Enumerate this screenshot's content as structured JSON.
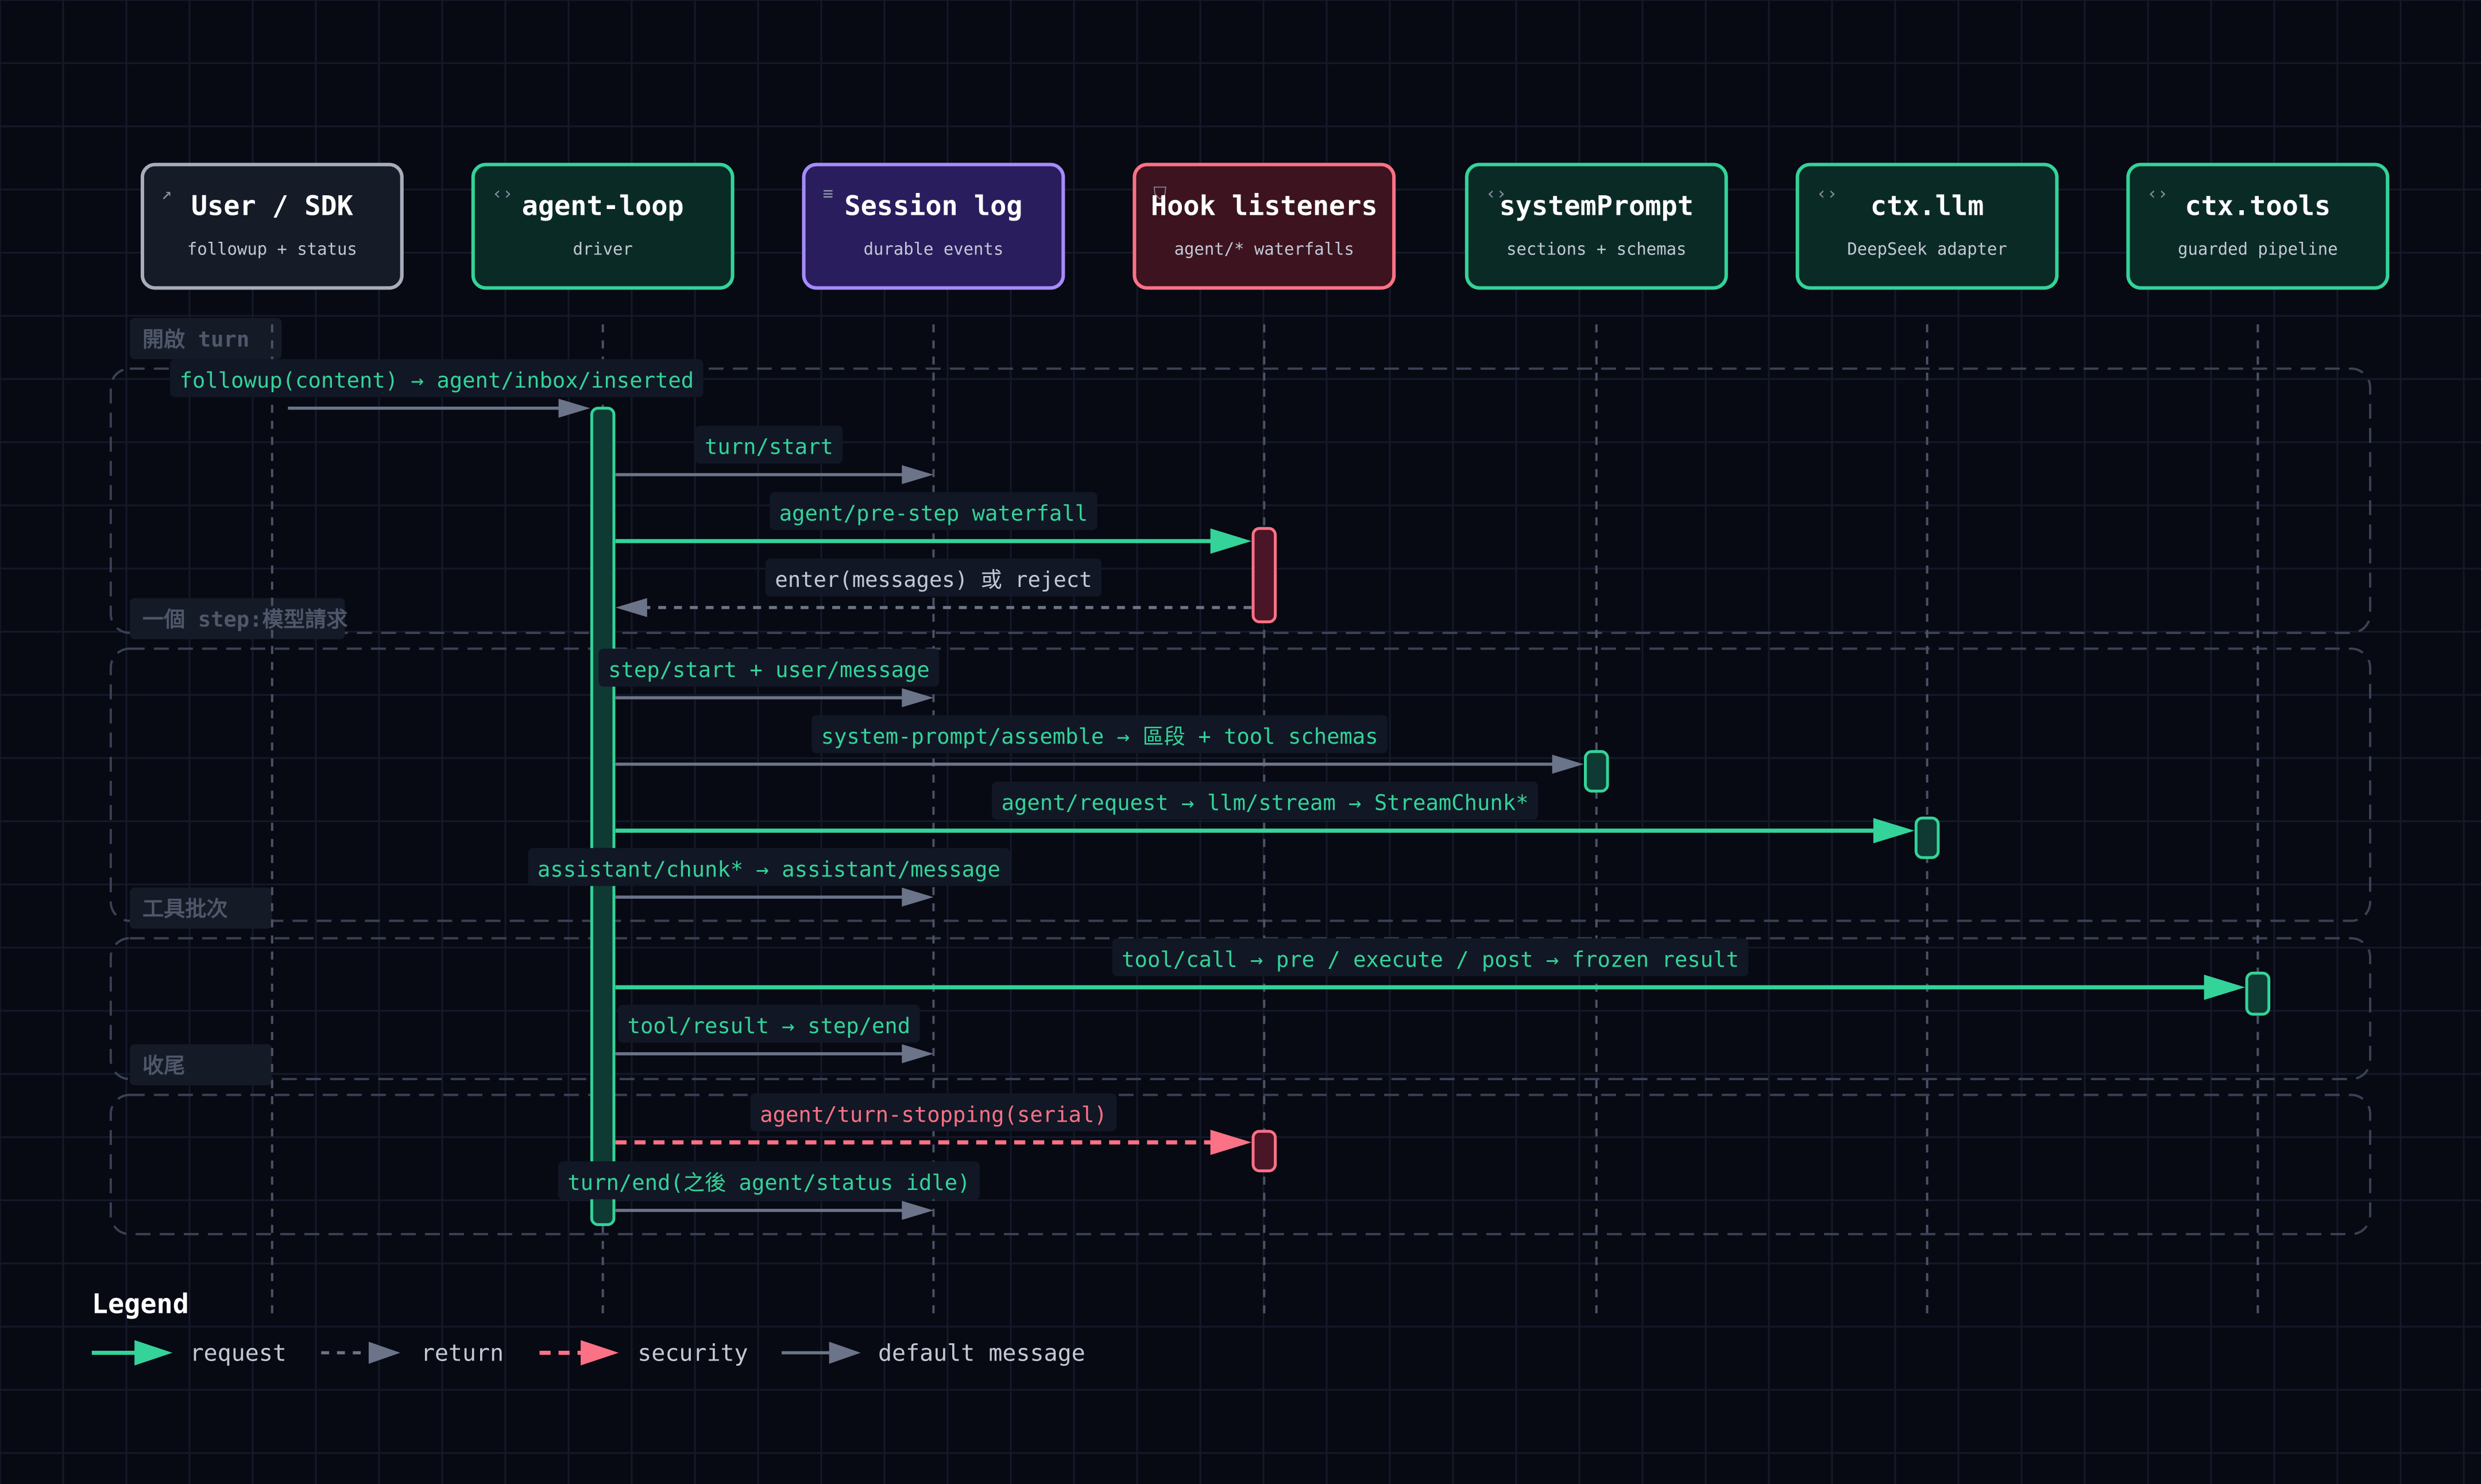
{
  "participants": [
    {
      "id": "user",
      "title": "User / SDK",
      "subtitle": "followup + status",
      "icon": "external-link-icon",
      "kind": "user"
    },
    {
      "id": "agent",
      "title": "agent-loop",
      "subtitle": "driver",
      "icon": "code-icon",
      "kind": "agent"
    },
    {
      "id": "session",
      "title": "Session log",
      "subtitle": "durable events",
      "icon": "database-icon",
      "kind": "session"
    },
    {
      "id": "hook",
      "title": "Hook listeners",
      "subtitle": "agent/* waterfalls",
      "icon": "shield-icon",
      "kind": "hook"
    },
    {
      "id": "sysprompt",
      "title": "systemPrompt",
      "subtitle": "sections + schemas",
      "icon": "code-icon",
      "kind": "agent"
    },
    {
      "id": "llm",
      "title": "ctx.llm",
      "subtitle": "DeepSeek adapter",
      "icon": "code-icon",
      "kind": "agent"
    },
    {
      "id": "tools",
      "title": "ctx.tools",
      "subtitle": "guarded pipeline",
      "icon": "code-icon",
      "kind": "agent"
    }
  ],
  "groups": [
    {
      "label": "開啟 turn"
    },
    {
      "label": "一個 step:模型請求"
    },
    {
      "label": "工具批次"
    },
    {
      "label": "收尾"
    }
  ],
  "messages": [
    {
      "label": "followup(content) → agent/inbox/inserted",
      "from": "user",
      "to": "agent",
      "style": "default"
    },
    {
      "label": "turn/start",
      "from": "agent",
      "to": "session",
      "style": "default"
    },
    {
      "label": "agent/pre-step waterfall",
      "from": "agent",
      "to": "hook",
      "style": "request"
    },
    {
      "label": "enter(messages) 或 reject",
      "from": "hook",
      "to": "agent",
      "style": "return"
    },
    {
      "label": "step/start + user/message",
      "from": "agent",
      "to": "session",
      "style": "default"
    },
    {
      "label": "system-prompt/assemble → 區段 + tool schemas",
      "from": "agent",
      "to": "sysprompt",
      "style": "default"
    },
    {
      "label": "agent/request → llm/stream → StreamChunk*",
      "from": "agent",
      "to": "llm",
      "style": "request"
    },
    {
      "label": "assistant/chunk* → assistant/message",
      "from": "agent",
      "to": "session",
      "style": "default"
    },
    {
      "label": "tool/call → pre / execute / post → frozen result",
      "from": "agent",
      "to": "tools",
      "style": "request"
    },
    {
      "label": "tool/result → step/end",
      "from": "agent",
      "to": "session",
      "style": "default"
    },
    {
      "label": "agent/turn-stopping(serial)",
      "from": "agent",
      "to": "hook",
      "style": "security"
    },
    {
      "label": "turn/end(之後 agent/status idle)",
      "from": "agent",
      "to": "session",
      "style": "default"
    }
  ],
  "legend": {
    "title": "Legend",
    "items": [
      {
        "style": "request",
        "label": "request"
      },
      {
        "style": "return",
        "label": "return"
      },
      {
        "style": "security",
        "label": "security"
      },
      {
        "style": "default",
        "label": "default message"
      }
    ]
  },
  "colors": {
    "background": "#070913",
    "grid": "#141a2a",
    "request": "#34d399",
    "return": "#6b7488",
    "security": "#fb7185",
    "default": "#6b7488",
    "lifeline": "#4a5266",
    "group_border": "#3a4154",
    "group_label_bg": "#151a27",
    "group_label_text": "#4f576a",
    "msg_label_bg": "#111725",
    "agent_fill": "#0a2a26",
    "agent_stroke": "#34d399",
    "user_fill": "#161b28",
    "user_stroke": "#a7adba",
    "session_fill": "#2a1d5e",
    "session_stroke": "#a78bfa",
    "hook_fill": "#3d1320",
    "hook_stroke": "#fb7185",
    "title_text": "#ffffff",
    "subtitle_text": "#c3c9d4",
    "icon_text": "#8a93a6"
  }
}
